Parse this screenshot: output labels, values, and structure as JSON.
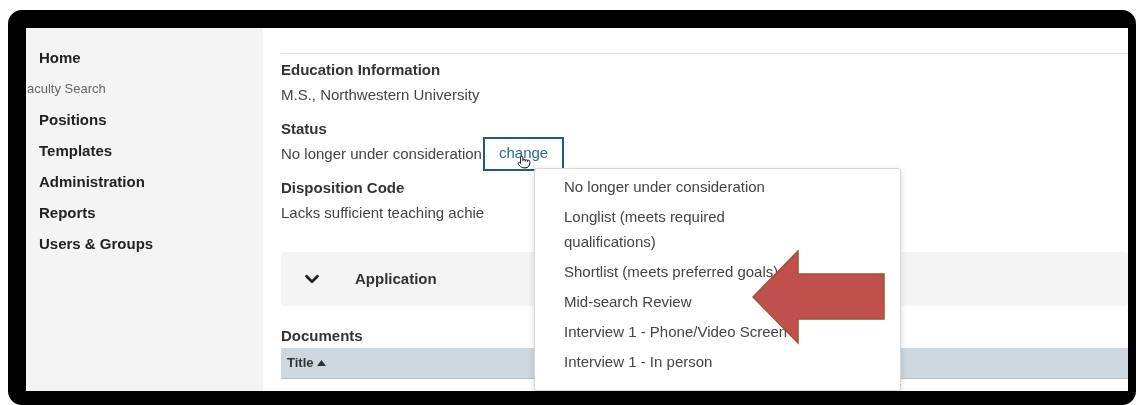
{
  "sidebar": {
    "items": [
      {
        "label": "Home",
        "kind": "link"
      },
      {
        "label": "aculty Search",
        "kind": "heading"
      },
      {
        "label": "Positions",
        "kind": "link"
      },
      {
        "label": "Templates",
        "kind": "link"
      },
      {
        "label": "Administration",
        "kind": "link"
      },
      {
        "label": "Reports",
        "kind": "link"
      },
      {
        "label": "Users & Groups",
        "kind": "link"
      }
    ]
  },
  "details": [
    {
      "label": "Education Information",
      "value": "M.S., Northwestern University"
    },
    {
      "label": "Status",
      "value": "No longer under consideration",
      "action": "change"
    },
    {
      "label": "Disposition Code",
      "value": "Lacks sufficient teaching achie"
    }
  ],
  "section": {
    "title": "Application"
  },
  "documents": {
    "title": "Documents",
    "columns": [
      {
        "label": "Title",
        "sort_ascending": true
      }
    ]
  },
  "status_menu": {
    "items": [
      "No longer under consideration",
      "Longlist (meets required qualifications)",
      "Shortlist (meets preferred goals)",
      "Mid-search Review",
      "Interview 1 - Phone/Video Screen",
      "Interview 1 - In person"
    ]
  }
}
